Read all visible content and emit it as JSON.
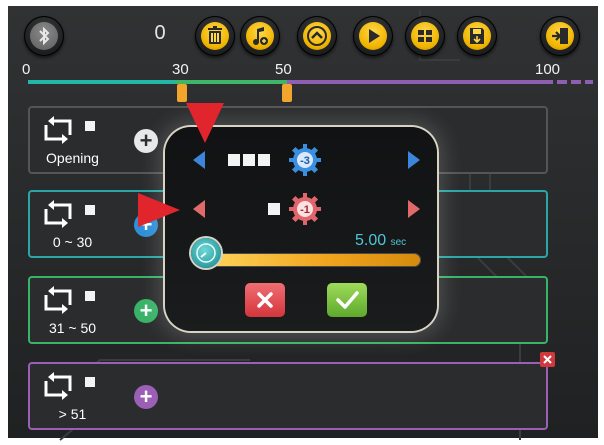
{
  "toolbar": {
    "counter": "0",
    "buttons": [
      {
        "icon": "bluetooth-icon"
      },
      {
        "icon": "trash-icon"
      },
      {
        "icon": "add-note-icon"
      },
      {
        "icon": "chevron-up-icon"
      },
      {
        "icon": "play-icon"
      },
      {
        "icon": "tiles-icon"
      },
      {
        "icon": "save-icon"
      },
      {
        "icon": "exit-icon"
      }
    ]
  },
  "timeline": {
    "ticks": [
      "0",
      "30",
      "50",
      "100"
    ],
    "colors": {
      "start": "#22b6a6",
      "middle": "#3fb56a",
      "end": "#8e5fb0",
      "marker": "#f2a52c"
    }
  },
  "rows": [
    {
      "label": "Opening",
      "color": "#7d7d7d"
    },
    {
      "label": "0 ~ 30",
      "color": "#2aa6a6"
    },
    {
      "label": "31 ~ 50",
      "color": "#38b368"
    },
    {
      "label": "> 51",
      "color": "#9b5fb6"
    }
  ],
  "modal": {
    "gear_top_value": "-3",
    "gear_bottom_value": "-1",
    "timer_value": "5.00",
    "timer_unit": "sec",
    "slider_level": 0
  }
}
